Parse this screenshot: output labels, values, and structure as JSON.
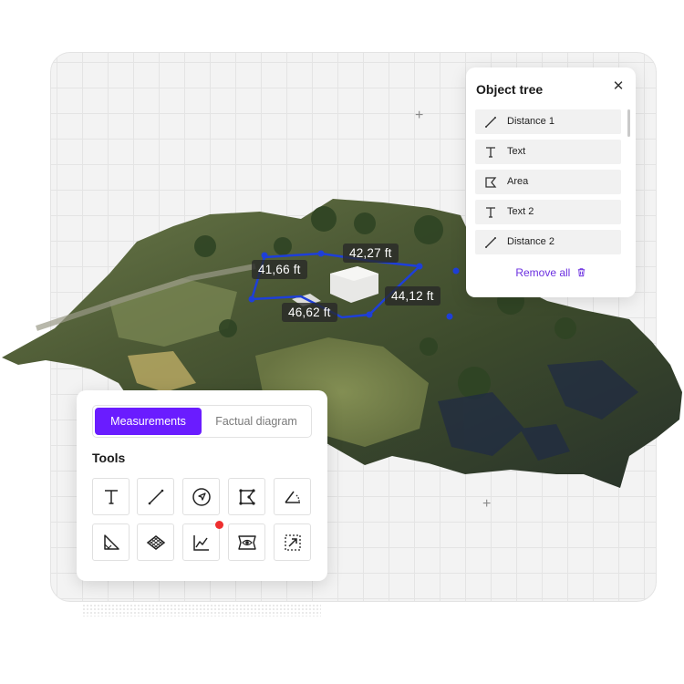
{
  "measurements": {
    "labels": [
      "41,66 ft",
      "42,27 ft",
      "44,12 ft",
      "46,62 ft"
    ],
    "line_color": "#1e3fd8"
  },
  "object_tree": {
    "title": "Object tree",
    "close_icon": "close-icon",
    "items": [
      {
        "label": "Distance 1",
        "icon": "line-icon"
      },
      {
        "label": "Text",
        "icon": "text-icon"
      },
      {
        "label": "Area",
        "icon": "area-icon"
      },
      {
        "label": "Text 2",
        "icon": "text-icon"
      },
      {
        "label": "Distance 2",
        "icon": "line-icon"
      }
    ],
    "remove_all_label": "Remove all",
    "remove_icon": "trash-icon"
  },
  "tools_panel": {
    "tabs": [
      {
        "label": "Measurements",
        "active": true
      },
      {
        "label": "Factual diagram",
        "active": false
      }
    ],
    "title": "Tools",
    "tools": [
      {
        "icon": "text-tool-icon"
      },
      {
        "icon": "distance-tool-icon"
      },
      {
        "icon": "navigation-tool-icon"
      },
      {
        "icon": "area-tool-icon"
      },
      {
        "icon": "angle-tool-icon"
      },
      {
        "icon": "slope-tool-icon"
      },
      {
        "icon": "surface-tool-icon"
      },
      {
        "icon": "elevation-profile-tool-icon"
      },
      {
        "icon": "view-tool-icon"
      },
      {
        "icon": "volume-tool-icon"
      }
    ],
    "notification_tool": "elevation-profile-tool-icon"
  },
  "colors": {
    "accent": "#6a1cff",
    "link": "#6b2fe0",
    "notification": "#ee2f2f"
  }
}
